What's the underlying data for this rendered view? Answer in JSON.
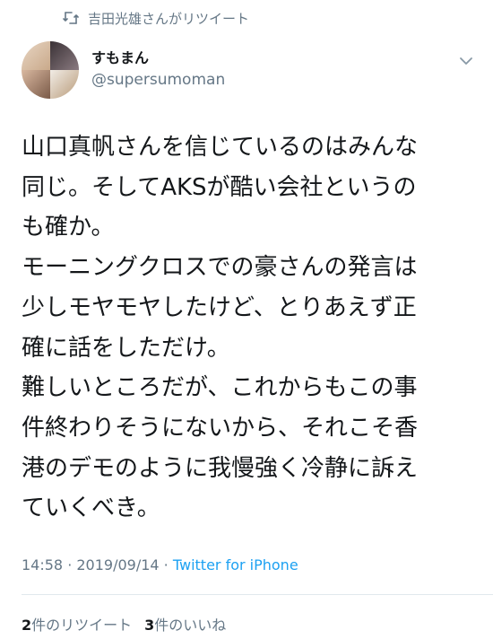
{
  "retweet_context": {
    "icon": "retweet-icon",
    "text": "吉田光雄さんがリツイート"
  },
  "author": {
    "display_name": "すもまん",
    "handle": "@supersumoman"
  },
  "tweet": {
    "lines": [
      "山口真帆さんを信じているのはみんな",
      "同じ。そしてAKSが酷い会社というの",
      "も確か。",
      "モーニングクロスでの豪さんの発言は",
      "少しモヤモヤしたけど、とりあえず正",
      "確に話をしただけ。",
      "難しいところだが、これからもこの事",
      "件終わりそうにないから、それこそ香",
      "港のデモのように我慢強く冷静に訴え",
      "ていくべき。"
    ]
  },
  "meta": {
    "time": "14:58",
    "separator1": " · ",
    "date": "2019/09/14",
    "separator2": " · ",
    "source": "Twitter for iPhone"
  },
  "stats": {
    "retweets_count": "2",
    "retweets_label": "件のリツイート",
    "likes_count": "3",
    "likes_label": "件のいいね"
  },
  "colors": {
    "text": "#14171a",
    "secondary": "#657786",
    "link": "#1da1f2",
    "divider": "#e1e8ed"
  }
}
